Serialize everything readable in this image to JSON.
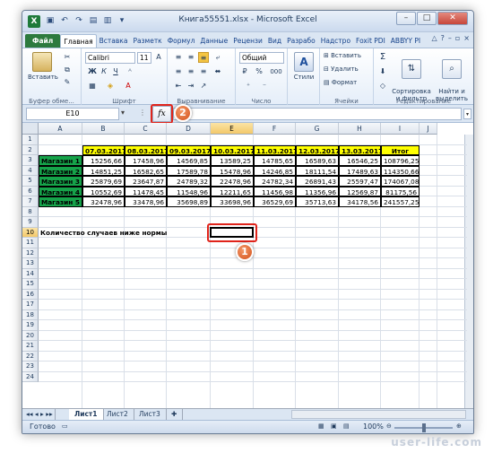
{
  "window": {
    "title": "Книга55551.xlsx - Microsoft Excel",
    "logo": "X",
    "buttons": [
      "–",
      "□",
      "✕"
    ]
  },
  "tabs": [
    "Файл",
    "Главная",
    "Вставка",
    "Разметк",
    "Формул",
    "Данные",
    "Рецензи",
    "Вид",
    "Разрабо",
    "Надстро",
    "Foxit PDI",
    "ABBYY PI"
  ],
  "ribbon": {
    "clipboard": {
      "paste": "Вставить",
      "label": "Буфер обме..."
    },
    "font": {
      "name": "Calibri",
      "size": "11",
      "label": "Шрифт",
      "bold": "Ж",
      "italic": "К",
      "underline": "Ч"
    },
    "alignment": {
      "label": "Выравнивание"
    },
    "number": {
      "format": "Общий",
      "label": "Число",
      "percent": "%",
      "thousands": "000"
    },
    "styles": {
      "label": "Стили"
    },
    "cells": {
      "insert": "Вставить",
      "delete": "Удалить",
      "format": "Формат",
      "label": "Ячейки"
    },
    "editing": {
      "sort": "Сортировка\nи фильтр",
      "find": "Найти и\nвыделить",
      "label": "Редактирование",
      "sigma": "Σ"
    }
  },
  "formula_bar": {
    "name_box": "E10",
    "fx": "fx",
    "value": ""
  },
  "columns": [
    "A",
    "B",
    "C",
    "D",
    "E",
    "F",
    "G",
    "H",
    "I",
    "J"
  ],
  "rows": [
    "1",
    "2",
    "3",
    "4",
    "5",
    "6",
    "7",
    "8",
    "9",
    "10",
    "11",
    "12",
    "13",
    "14",
    "15",
    "16",
    "17",
    "18",
    "19",
    "20",
    "21",
    "22",
    "23",
    "24"
  ],
  "table": {
    "dates": [
      "07.03.2017",
      "08.03.2017",
      "09.03.2017",
      "10.03.2017",
      "11.03.2017",
      "12.03.2017",
      "13.03.2017"
    ],
    "total_header": "Итог",
    "stores": [
      {
        "name": "Магазин 1",
        "values": [
          "15256,66",
          "17458,96",
          "14569,85",
          "13589,25",
          "14785,65",
          "16589,63",
          "16546,25"
        ],
        "total": "108796,25"
      },
      {
        "name": "Магазин 2",
        "values": [
          "14851,25",
          "16582,65",
          "17589,78",
          "15478,96",
          "14246,85",
          "18111,54",
          "17489,63"
        ],
        "total": "114350,66"
      },
      {
        "name": "Магазин 3",
        "values": [
          "25879,69",
          "23647,87",
          "24789,32",
          "22478,96",
          "24782,34",
          "26891,43",
          "25597,47"
        ],
        "total": "174067,08"
      },
      {
        "name": "Магазин 4",
        "values": [
          "10552,69",
          "11478,45",
          "11548,96",
          "12211,65",
          "11456,98",
          "11356,96",
          "12569,87"
        ],
        "total": "81175,56"
      },
      {
        "name": "Магазин 5",
        "values": [
          "32478,96",
          "33478,96",
          "35698,89",
          "33698,96",
          "36529,69",
          "35713,63",
          "34178,56"
        ],
        "total": "241557,25"
      }
    ],
    "note": "Количество случаев ниже нормы"
  },
  "callouts": {
    "one": "1",
    "two": "2"
  },
  "sheets": [
    "Лист1",
    "Лист2",
    "Лист3"
  ],
  "status": {
    "ready": "Готово",
    "zoom": "100%"
  },
  "watermark": "user-life.com"
}
